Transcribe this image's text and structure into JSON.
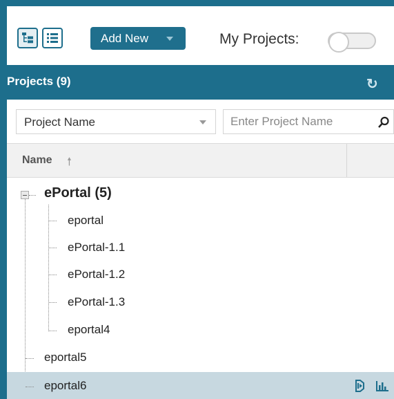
{
  "toolbar": {
    "tree_view_icon": "tree-view-icon",
    "list_view_icon": "list-view-icon",
    "add_new_label": "Add New",
    "my_projects_label": "My Projects:",
    "my_projects_toggle": "off"
  },
  "panel": {
    "title": "Projects (9)",
    "refresh_icon": "refresh-icon"
  },
  "filter": {
    "field_selected": "Project Name",
    "search_placeholder": "Enter Project Name",
    "search_icon": "search-icon"
  },
  "grid": {
    "column_name": "Name",
    "sort_icon": "sort-ascending-icon"
  },
  "tree": {
    "group_label": "ePortal (5)",
    "children": [
      "eportal",
      "ePortal-1.1",
      "ePortal-1.2",
      "ePortal-1.3",
      "eportal4"
    ],
    "root_items": [
      "eportal5",
      "eportal6"
    ],
    "selected_row_icons": [
      "project-details-icon",
      "bar-chart-icon"
    ]
  },
  "colors": {
    "accent": "#1d6e8c",
    "selected_row": "#c7d8e0"
  }
}
